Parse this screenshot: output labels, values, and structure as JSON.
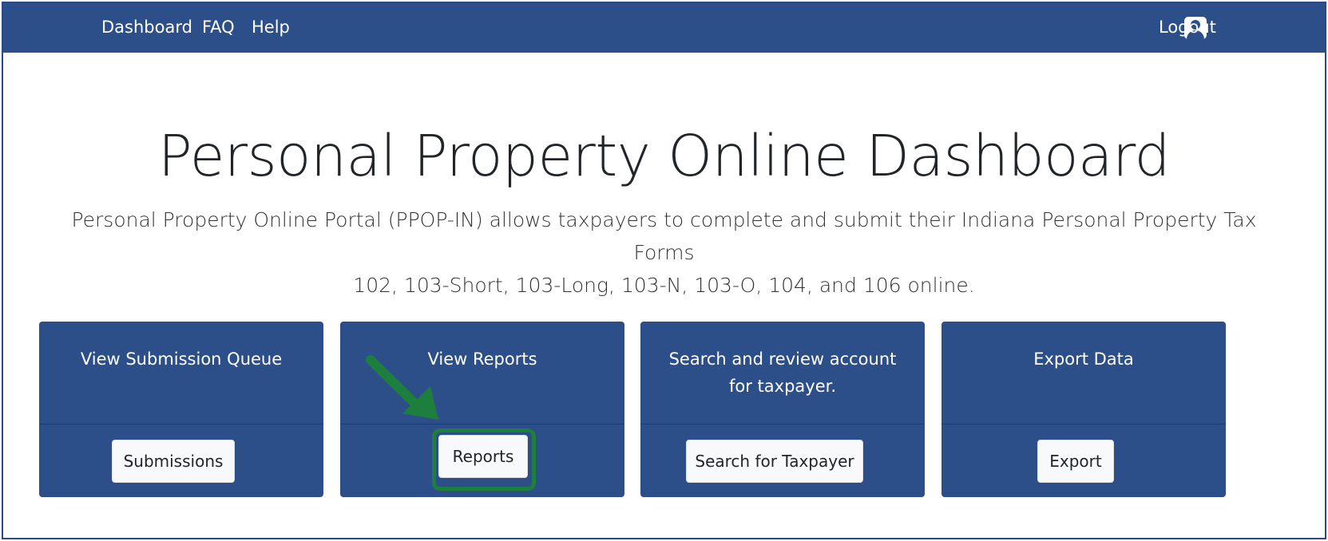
{
  "nav": {
    "dashboard": "Dashboard",
    "faq": "FAQ",
    "help": "Help",
    "logout": "Logout",
    "user_icon": "user-icon"
  },
  "page": {
    "title": "Personal Property Online Dashboard",
    "lead_line1": "Personal Property Online Portal (PPOP-IN) allows taxpayers to complete and submit their Indiana Personal Property Tax Forms",
    "lead_line2": "102, 103-Short, 103-Long, 103-N, 103-O, 104, and 106 online."
  },
  "cards": [
    {
      "title_line1": "View Submission Queue",
      "title_line2": "",
      "button": "Submissions"
    },
    {
      "title_line1": "View Reports",
      "title_line2": "",
      "button": "Reports"
    },
    {
      "title_line1": "Search and review account",
      "title_line2": "for taxpayer.",
      "button": "Search for Taxpayer"
    },
    {
      "title_line1": "Export Data",
      "title_line2": "",
      "button": "Export"
    }
  ],
  "colors": {
    "brand": "#2c4f8a",
    "annotation": "#1e7e3e"
  }
}
